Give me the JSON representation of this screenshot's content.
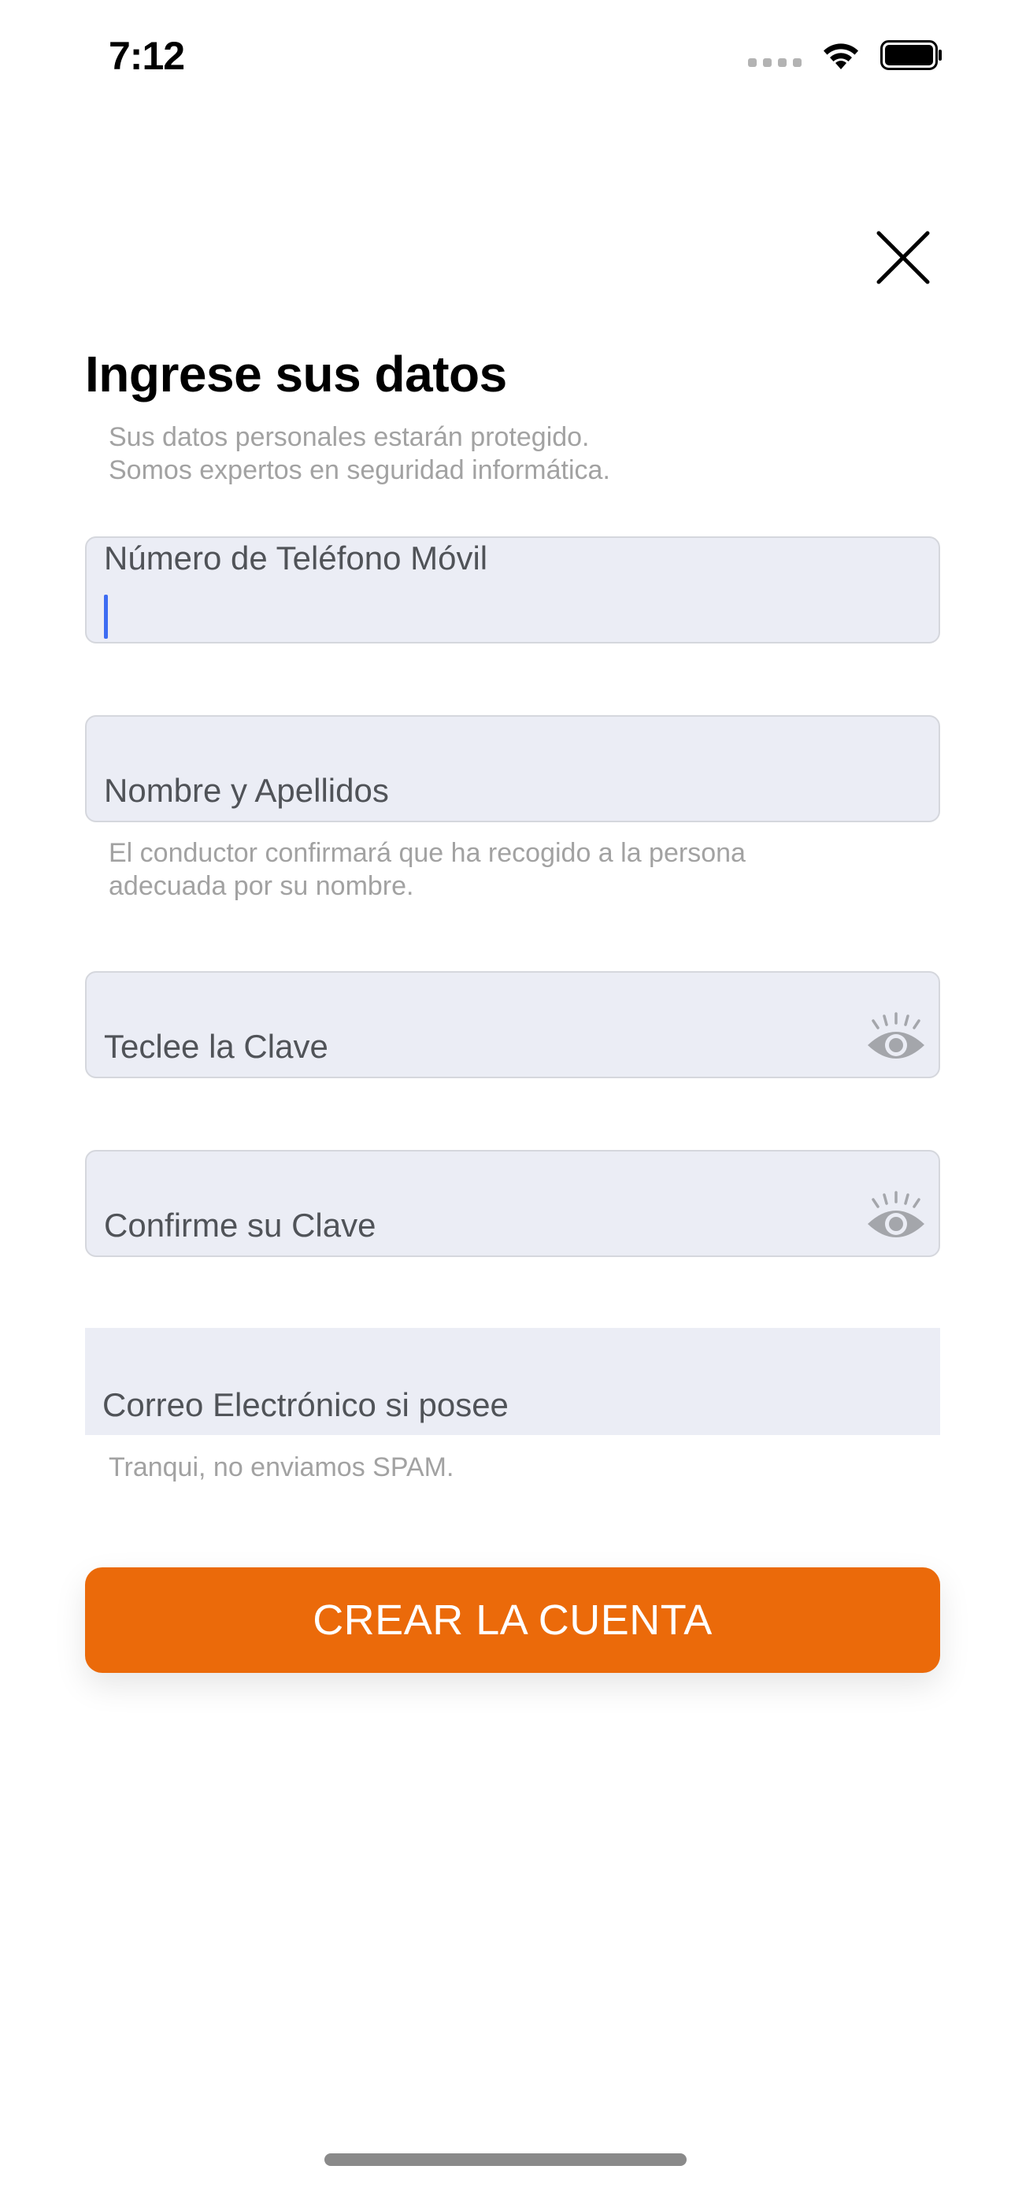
{
  "status_bar": {
    "time": "7:12"
  },
  "header": {
    "title": "Ingrese sus datos",
    "subtitle": "Sus datos personales estarán protegido.\nSomos expertos en seguridad informática."
  },
  "fields": {
    "phone": {
      "label": "Número de Teléfono Móvil",
      "value": ""
    },
    "name": {
      "label": "Nombre y Apellidos",
      "value": "",
      "hint": "El conductor confirmará que ha recogido a la persona\nadecuada por su nombre."
    },
    "password": {
      "label": "Teclee la Clave",
      "value": ""
    },
    "confirm_password": {
      "label": "Confirme su Clave",
      "value": ""
    },
    "email": {
      "label": "Correo Electrónico si posee",
      "value": "",
      "hint": "Tranqui, no enviamos SPAM."
    }
  },
  "actions": {
    "create_account": "CREAR LA CUENTA"
  },
  "colors": {
    "accent": "#eb6a0a",
    "field_bg": "#ebedf5",
    "caret": "#3d6cf2",
    "hint_text": "#a2a2a2"
  },
  "icons": {
    "close": "close-icon",
    "password_toggle": "eye-icon"
  }
}
